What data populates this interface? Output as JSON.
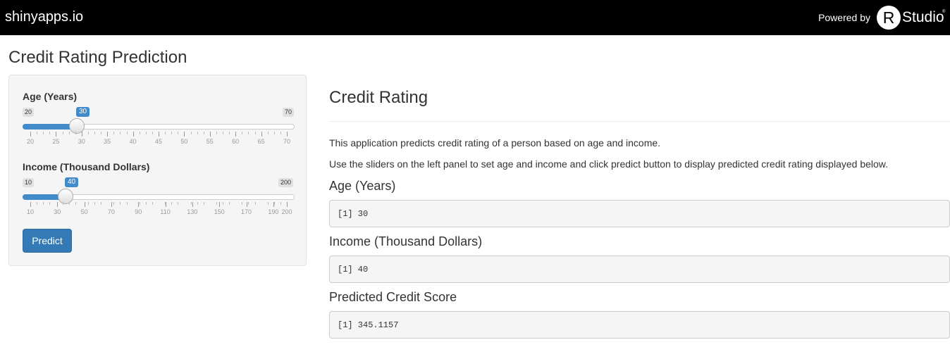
{
  "topbar": {
    "brand": "shinyapps.io",
    "powered_by": "Powered by",
    "r_logo": "R",
    "studio": "Studio",
    "registered": "®"
  },
  "page_title": "Credit Rating Prediction",
  "sidebar": {
    "age_slider": {
      "label": "Age (Years)",
      "min": "20",
      "max": "70",
      "value": "30",
      "value_fraction": 0.2,
      "ticks": [
        "20",
        "25",
        "30",
        "35",
        "40",
        "45",
        "50",
        "55",
        "60",
        "65",
        "70"
      ]
    },
    "income_slider": {
      "label": "Income (Thousand Dollars)",
      "min": "10",
      "max": "200",
      "value": "40",
      "value_fraction": 0.158,
      "ticks": [
        "10",
        "30",
        "50",
        "70",
        "90",
        "110",
        "130",
        "150",
        "170",
        "190",
        "200"
      ]
    },
    "predict_label": "Predict"
  },
  "main": {
    "heading": "Credit Rating",
    "description_1": "This application predicts credit rating of a person based on age and income.",
    "description_2": "Use the sliders on the left panel to set age and income and click predict button to display predicted credit rating displayed below.",
    "age_heading": "Age (Years)",
    "age_output": "[1] 30",
    "income_heading": "Income (Thousand Dollars)",
    "income_output": "[1] 40",
    "score_heading": "Predicted Credit Score",
    "score_output": "[1] 345.1157"
  },
  "colors": {
    "topbar_bg": "#000000",
    "accent": "#428bca",
    "button": "#337ab7"
  }
}
